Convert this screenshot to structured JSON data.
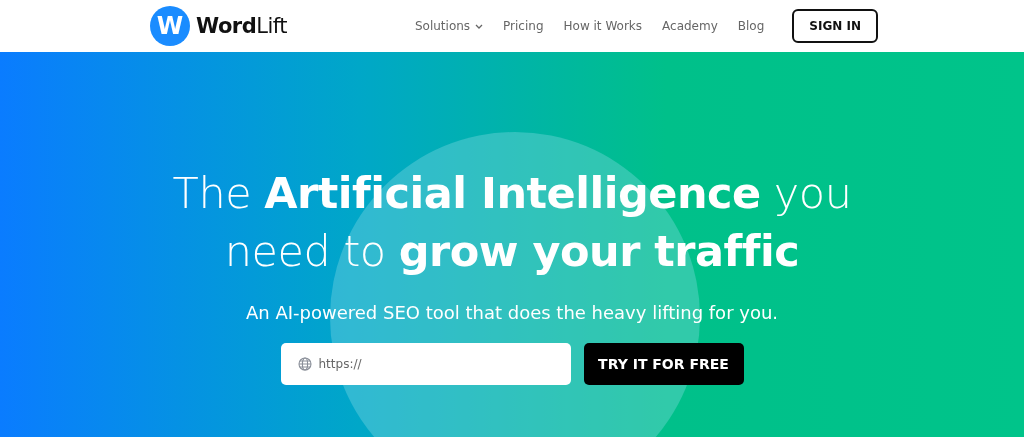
{
  "header": {
    "logo_mark": "W",
    "logo_text": "**Word**Lift",
    "nav": [
      {
        "label": "Solutions",
        "has_dropdown": true
      },
      {
        "label": "Pricing",
        "has_dropdown": false
      },
      {
        "label": "How it Works",
        "has_dropdown": false
      },
      {
        "label": "Academy",
        "has_dropdown": false
      },
      {
        "label": "Blog",
        "has_dropdown": false
      }
    ],
    "sign_in": "SIGN IN"
  },
  "hero": {
    "headline_lines": [
      "The **Artificial Intelligence** you",
      "need to **grow your traffic**"
    ],
    "subtitle": "An AI-powered SEO tool that does the heavy lifting for you.",
    "url_field": {
      "placeholder": "https://"
    },
    "cta": "TRY IT FOR FREE"
  }
}
